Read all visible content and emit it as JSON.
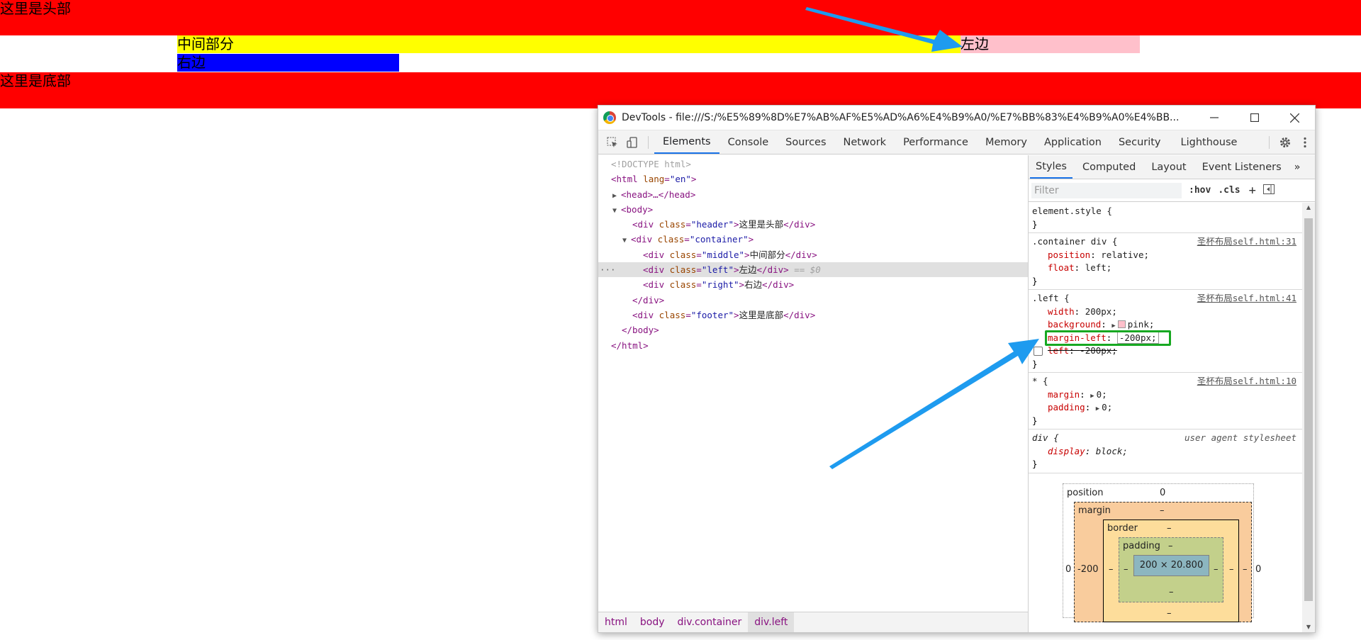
{
  "page": {
    "header_text": "这里是头部",
    "middle_text": "中间部分",
    "left_text": "左边",
    "right_text": "右边",
    "footer_text": "这里是底部"
  },
  "devtools": {
    "title": "DevTools - file:///S:/%E5%89%8D%E7%AB%AF%E5%AD%A6%E4%B9%A0/%E7%BB%83%E4%B9%A0%E4%BB...",
    "tabs": [
      "Elements",
      "Console",
      "Sources",
      "Network",
      "Performance",
      "Memory",
      "Application",
      "Security",
      "Lighthouse"
    ],
    "active_tab": "Elements",
    "elements": {
      "doctype": "<!DOCTYPE html>",
      "html_tag": "html",
      "html_attr": "lang",
      "html_val": "\"en\"",
      "head": "<head>…</head>",
      "body_open": "<body>",
      "body_close": "</body>",
      "html_close": "</html>",
      "container_close": "</div>",
      "nodes": [
        {
          "cls": "\"header\"",
          "text": "这里是头部"
        },
        {
          "cls": "\"container\"",
          "text": ""
        },
        {
          "cls": "\"middle\"",
          "text": "中间部分"
        },
        {
          "cls": "\"left\"",
          "text": "左边",
          "suffix": "== $0"
        },
        {
          "cls": "\"right\"",
          "text": "右边"
        },
        {
          "cls": "\"footer\"",
          "text": "这里是底部"
        }
      ]
    },
    "breadcrumbs": [
      "html",
      "body",
      "div.container",
      "div.left"
    ],
    "styles": {
      "tabs": [
        "Styles",
        "Computed",
        "Layout",
        "Event Listeners"
      ],
      "more": "»",
      "filter_placeholder": "Filter",
      "hov": ":hov",
      "cls": ".cls",
      "plus": "+",
      "rules": [
        {
          "selector": "element.style {",
          "source": "",
          "decls": [],
          "close": "}"
        },
        {
          "selector": ".container div {",
          "source": "圣杯布局self.html:31",
          "decls": [
            [
              "position",
              "relative;"
            ],
            [
              "float",
              "left;"
            ]
          ],
          "close": "}"
        },
        {
          "selector": ".left {",
          "source": "圣杯布局self.html:41",
          "decls": [
            [
              "width",
              "200px;"
            ],
            [
              "background",
              "pink;"
            ],
            [
              "margin-left",
              "-200px;"
            ],
            [
              "left",
              "-200px;"
            ]
          ],
          "close": "}"
        },
        {
          "selector": "* {",
          "source": "圣杯布局self.html:10",
          "decls": [
            [
              "margin",
              "0;"
            ],
            [
              "padding",
              "0;"
            ]
          ],
          "close": "}"
        },
        {
          "selector": "div {",
          "source": "user agent stylesheet",
          "decls": [
            [
              "display",
              "block;"
            ]
          ],
          "close": "}"
        }
      ]
    },
    "box_model": {
      "position_label": "position",
      "position_val": "0",
      "margin_label": "margin",
      "margin_top": "–",
      "margin_left": "-200",
      "margin_right": "–",
      "outer_left": "0",
      "outer_right": "0",
      "border_label": "border",
      "border_top": "–",
      "border_left": "–",
      "border_right": "–",
      "padding_label": "padding",
      "padding_top": "–",
      "padding_left": "–",
      "padding_right": "–",
      "padding_bottom": "–",
      "content": "200 × 20.800",
      "border_bottom": "–"
    }
  },
  "colors": {
    "header": "#ff0000",
    "middle": "#ffff00",
    "left": "#ffc0cb",
    "right": "#0000ff",
    "footer": "#ff0000",
    "annotation_arrow": "#1e9bef",
    "highlight_box": "#17a821"
  }
}
